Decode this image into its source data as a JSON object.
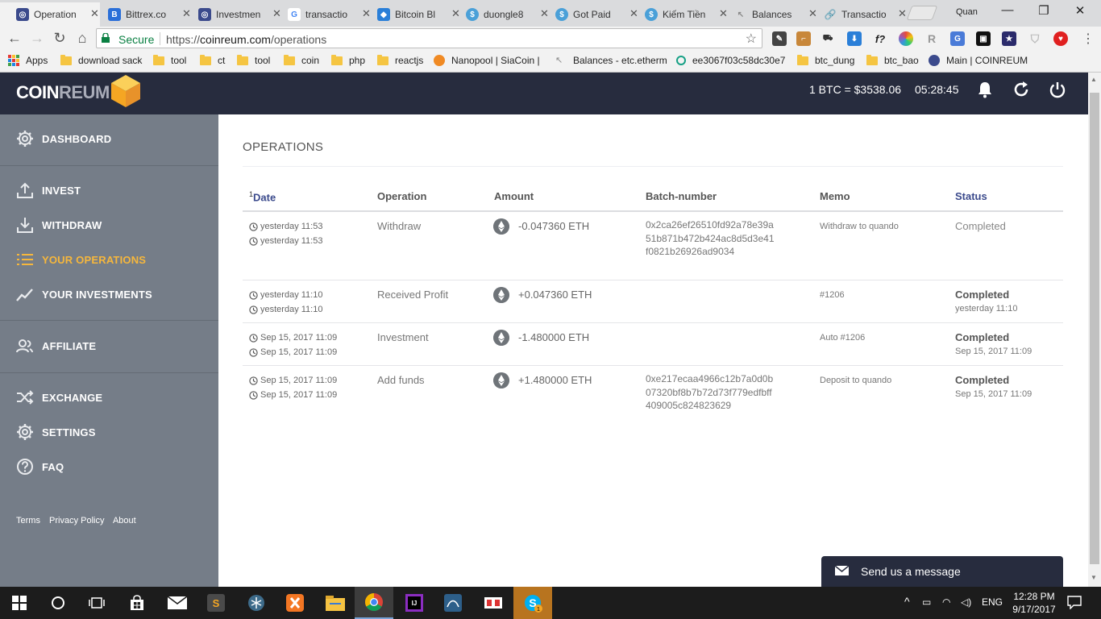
{
  "browser": {
    "tabs": [
      {
        "title": "Operation",
        "color": "#3b4a8c",
        "glyph": "◎"
      },
      {
        "title": "Bittrex.co",
        "color": "#2a6fd8",
        "glyph": "B"
      },
      {
        "title": "Investmen",
        "color": "#3b4a8c",
        "glyph": "◎"
      },
      {
        "title": "transactio",
        "color": "#ffffff",
        "glyph": "G"
      },
      {
        "title": "Bitcoin Bl",
        "color": "#2a7fd8",
        "glyph": "◆"
      },
      {
        "title": "duongle8",
        "color": "#4aa0d8",
        "glyph": "$"
      },
      {
        "title": "Got Paid",
        "color": "#4aa0d8",
        "glyph": "$"
      },
      {
        "title": "Kiếm Tiền",
        "color": "#4aa0d8",
        "glyph": "$"
      },
      {
        "title": "Balances",
        "color": "#888888",
        "glyph": "↖"
      },
      {
        "title": "Transactio",
        "color": "#444444",
        "glyph": "🔗"
      }
    ],
    "profile_name": "Quan",
    "window_controls": {
      "minimize": "—",
      "maximize": "❐",
      "close": "✕"
    },
    "secure_label": "Secure",
    "url_scheme": "https://",
    "url_host": "coinreum.com",
    "url_path": "/operations",
    "bookmarks": [
      {
        "label": "Apps",
        "kind": "apps"
      },
      {
        "label": "download sack",
        "kind": "folder"
      },
      {
        "label": "tool",
        "kind": "folder"
      },
      {
        "label": "ct",
        "kind": "folder"
      },
      {
        "label": "tool",
        "kind": "folder"
      },
      {
        "label": "coin",
        "kind": "folder"
      },
      {
        "label": "php",
        "kind": "folder"
      },
      {
        "label": "reactjs",
        "kind": "folder"
      },
      {
        "label": "Nanopool | SiaCoin |",
        "kind": "site",
        "color": "#f08a24"
      },
      {
        "label": "Balances - etc.etherm",
        "kind": "site",
        "color": "#888888"
      },
      {
        "label": "ee3067f03c58dc30e7",
        "kind": "site",
        "color": "#16a085"
      },
      {
        "label": "btc_dung",
        "kind": "folder"
      },
      {
        "label": "btc_bao",
        "kind": "folder"
      },
      {
        "label": "Main | COINREUM",
        "kind": "site",
        "color": "#3b4a8c"
      }
    ]
  },
  "header": {
    "logo_bold": "COIN",
    "logo_dim": "REUM",
    "btc_rate": "1 BTC = $3538.06",
    "clock": "05:28:45"
  },
  "sidebar": {
    "items": [
      {
        "label": "DASHBOARD",
        "icon": "gear-icon"
      },
      {
        "label": "INVEST",
        "icon": "upload-icon"
      },
      {
        "label": "WITHDRAW",
        "icon": "download-icon"
      },
      {
        "label": "YOUR OPERATIONS",
        "icon": "list-icon"
      },
      {
        "label": "YOUR INVESTMENTS",
        "icon": "chart-line-icon"
      },
      {
        "label": "AFFILIATE",
        "icon": "users-icon"
      },
      {
        "label": "EXCHANGE",
        "icon": "shuffle-icon"
      },
      {
        "label": "SETTINGS",
        "icon": "gear-icon"
      },
      {
        "label": "FAQ",
        "icon": "question-icon"
      }
    ],
    "footer_links": [
      "Terms",
      "Privacy Policy",
      "About"
    ]
  },
  "page": {
    "title": "OPERATIONS",
    "table": {
      "headers": {
        "date_marker": "1",
        "date": "Date",
        "operation": "Operation",
        "amount": "Amount",
        "batch": "Batch-number",
        "memo": "Memo",
        "status": "Status"
      },
      "rows": [
        {
          "date1": "yesterday 11:53",
          "date2": "yesterday 11:53",
          "operation": "Withdraw",
          "amount": "-0.047360 ETH",
          "batch": "0x2ca26ef26510fd92a78e39a51b871b472b424ac8d5d3e41f0821b26926ad9034",
          "memo": "Withdraw to quando",
          "status": "Completed",
          "status_date": ""
        },
        {
          "date1": "yesterday 11:10",
          "date2": "yesterday 11:10",
          "operation": "Received Profit",
          "amount": "+0.047360 ETH",
          "batch": "",
          "memo": "#1206",
          "status": "Completed",
          "status_date": "yesterday 11:10"
        },
        {
          "date1": "Sep 15, 2017 11:09",
          "date2": "Sep 15, 2017 11:09",
          "operation": "Investment",
          "amount": "-1.480000 ETH",
          "batch": "",
          "memo": "Auto #1206",
          "status": "Completed",
          "status_date": "Sep 15, 2017 11:09"
        },
        {
          "date1": "Sep 15, 2017 11:09",
          "date2": "Sep 15, 2017 11:09",
          "operation": "Add funds",
          "amount": "+1.480000 ETH",
          "batch": "0xe217ecaa4966c12b7a0d0b07320bf8b7b72d73f779edfbff409005c824823629",
          "memo": "Deposit to quando",
          "status": "Completed",
          "status_date": "Sep 15, 2017 11:09"
        }
      ]
    }
  },
  "chat": {
    "label": "Send us a message"
  },
  "taskbar": {
    "language": "ENG",
    "time": "12:28 PM",
    "date": "9/17/2017",
    "skype_badge": "1"
  },
  "colors": {
    "header_bg": "#272c3e",
    "sidebar_bg": "#757d88",
    "active_accent": "#f6b73c",
    "link_blue": "#3b4a8c"
  }
}
